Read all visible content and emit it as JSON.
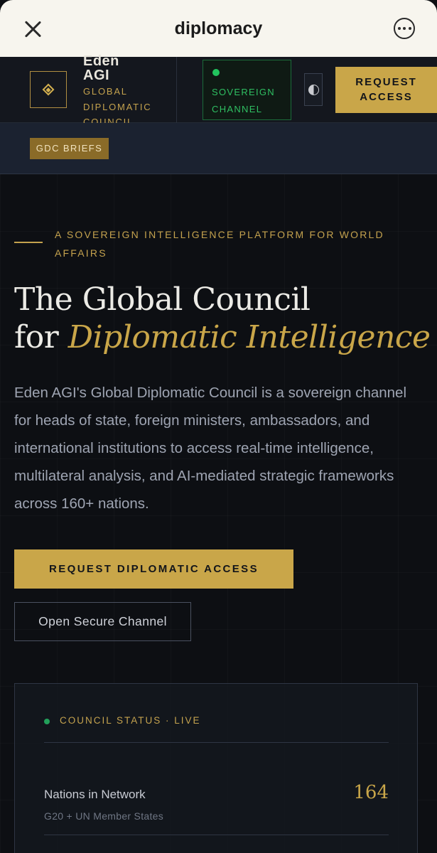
{
  "browser": {
    "title": "diplomacy",
    "close_icon": "close-icon",
    "more_icon": "more-options-icon"
  },
  "header": {
    "brand_name_line1": "Eden",
    "brand_name_line2": "AGI",
    "brand_sub": [
      "GLOBAL",
      "DIPLOMATIC",
      "COUNCIL"
    ],
    "logo_icon": "diamond-icon",
    "channel_label_line1": "SOVEREIGN",
    "channel_label_line2": "CHANNEL",
    "channel_status_color": "#22c55e",
    "theme_toggle_icon": "half-circle-icon",
    "request_line1": "REQUEST",
    "request_line2": "ACCESS"
  },
  "briefs": {
    "label": "GDC BRIEFS"
  },
  "hero": {
    "eyebrow": "A SOVEREIGN INTELLIGENCE PLATFORM FOR WORLD AFFAIRS",
    "headline_line1": "The Global Council",
    "headline_prefix": "for ",
    "headline_emphasis": "Diplomatic Intelligence",
    "lead": "Eden AGI's Global Diplomatic Council is a sovereign channel for heads of state, foreign ministers, ambassadors, and international institutions to access real-time intelligence, multilateral analysis, and AI-mediated strategic frameworks across 160+ nations.",
    "cta_primary": "REQUEST DIPLOMATIC ACCESS",
    "cta_secondary": "Open Secure Channel"
  },
  "status": {
    "title": "COUNCIL STATUS · LIVE",
    "stats": [
      {
        "label": "Nations in Network",
        "sub": "G20 + UN Member States",
        "value": "164"
      }
    ]
  },
  "colors": {
    "accent_gold": "#c9a649",
    "live_green": "#22c55e",
    "background": "#0d0f13"
  }
}
